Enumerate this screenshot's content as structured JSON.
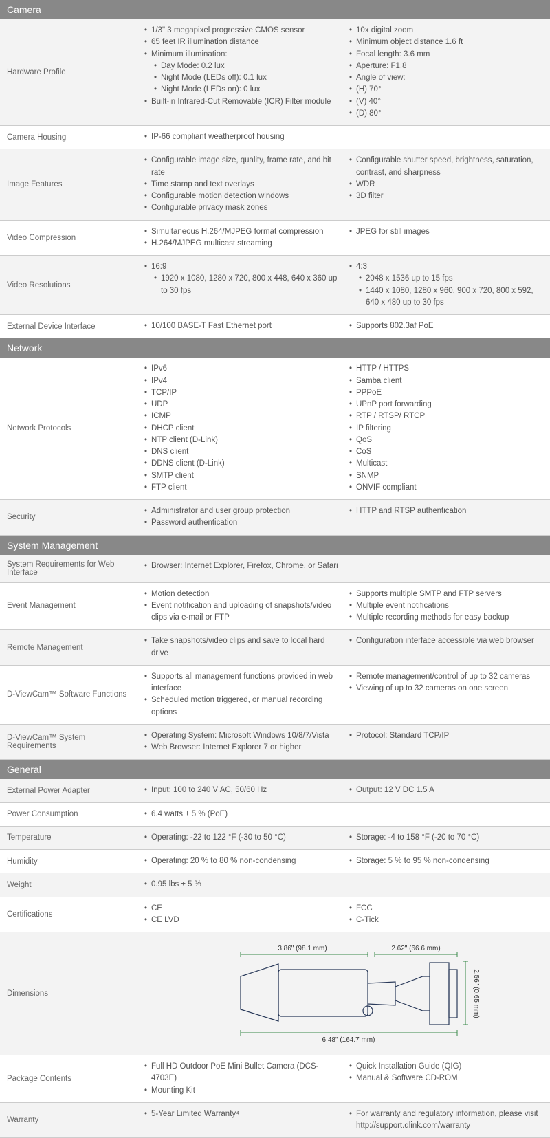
{
  "sections": [
    {
      "title": "Camera",
      "rows": [
        {
          "label": "Hardware Profile",
          "cols": [
            [
              {
                "t": "1/3\" 3 megapixel progressive CMOS sensor"
              },
              {
                "t": "65 feet IR illumination distance"
              },
              {
                "t": "Minimum illumination:"
              },
              {
                "t": "Day Mode: 0.2 lux",
                "indent": 1
              },
              {
                "t": "Night Mode (LEDs off): 0.1 lux",
                "indent": 1
              },
              {
                "t": "Night Mode (LEDs on): 0 lux",
                "indent": 1
              },
              {
                "t": "Built-in Infrared-Cut Removable (ICR) Filter module"
              }
            ],
            [
              {
                "t": "10x digital zoom"
              },
              {
                "t": "Minimum object distance 1.6 ft"
              },
              {
                "t": "Focal length: 3.6 mm"
              },
              {
                "t": "Aperture: F1.8"
              },
              {
                "t": "Angle of view:"
              },
              {
                "t": "(H) 70°"
              },
              {
                "t": "(V) 40°"
              },
              {
                "t": "(D) 80°"
              }
            ]
          ]
        },
        {
          "label": "Camera Housing",
          "cols": [
            [
              {
                "t": "IP-66 compliant weatherproof housing"
              }
            ]
          ]
        },
        {
          "label": "Image Features",
          "cols": [
            [
              {
                "t": "Configurable image size, quality, frame rate, and bit rate"
              },
              {
                "t": "Time stamp and text overlays"
              },
              {
                "t": "Configurable motion detection windows"
              },
              {
                "t": "Configurable privacy mask zones"
              }
            ],
            [
              {
                "t": "Configurable shutter speed, brightness, saturation, contrast, and sharpness"
              },
              {
                "t": "WDR"
              },
              {
                "t": "3D filter"
              }
            ]
          ]
        },
        {
          "label": "Video Compression",
          "cols": [
            [
              {
                "t": "Simultaneous H.264/MJPEG format compression"
              },
              {
                "t": "H.264/MJPEG multicast streaming"
              }
            ],
            [
              {
                "t": "JPEG for still images"
              }
            ]
          ]
        },
        {
          "label": "Video Resolutions",
          "cols": [
            [
              {
                "t": "16:9"
              },
              {
                "t": "1920 x 1080, 1280 x 720, 800 x 448, 640 x 360 up to 30 fps",
                "indent": 1
              }
            ],
            [
              {
                "t": "4:3"
              },
              {
                "t": "2048 x 1536 up to 15 fps",
                "indent": 1
              },
              {
                "t": "1440 x 1080, 1280 x 960, 900 x 720, 800 x 592, 640 x 480 up to 30 fps",
                "indent": 1
              }
            ]
          ]
        },
        {
          "label": "External Device Interface",
          "cols": [
            [
              {
                "t": "10/100 BASE-T Fast Ethernet port"
              }
            ],
            [
              {
                "t": "Supports 802.3af PoE"
              }
            ]
          ]
        }
      ]
    },
    {
      "title": "Network",
      "rows": [
        {
          "label": "Network Protocols",
          "cols": [
            [
              {
                "t": "IPv6"
              },
              {
                "t": "IPv4"
              },
              {
                "t": "TCP/IP"
              },
              {
                "t": "UDP"
              },
              {
                "t": "ICMP"
              },
              {
                "t": "DHCP client"
              },
              {
                "t": "NTP client (D-Link)"
              },
              {
                "t": "DNS client"
              },
              {
                "t": "DDNS client (D-Link)"
              },
              {
                "t": "SMTP client"
              },
              {
                "t": "FTP client"
              }
            ],
            [
              {
                "t": "HTTP / HTTPS"
              },
              {
                "t": "Samba client"
              },
              {
                "t": "PPPoE"
              },
              {
                "t": "UPnP port forwarding"
              },
              {
                "t": "RTP / RTSP/ RTCP"
              },
              {
                "t": "IP filtering"
              },
              {
                "t": "QoS"
              },
              {
                "t": "CoS"
              },
              {
                "t": "Multicast"
              },
              {
                "t": "SNMP"
              },
              {
                "t": "ONVIF compliant"
              }
            ]
          ]
        },
        {
          "label": "Security",
          "cols": [
            [
              {
                "t": "Administrator and user group protection"
              },
              {
                "t": "Password authentication"
              }
            ],
            [
              {
                "t": "HTTP and RTSP authentication"
              }
            ]
          ]
        }
      ]
    },
    {
      "title": "System Management",
      "rows": [
        {
          "label": "System Requirements for Web Interface",
          "cols": [
            [
              {
                "t": "Browser: Internet Explorer, Firefox, Chrome, or Safari"
              }
            ]
          ]
        },
        {
          "label": "Event Management",
          "cols": [
            [
              {
                "t": "Motion detection"
              },
              {
                "t": "Event notification and uploading of snapshots/video clips via e-mail or FTP"
              }
            ],
            [
              {
                "t": "Supports multiple SMTP and FTP servers"
              },
              {
                "t": "Multiple event notifications"
              },
              {
                "t": "Multiple recording methods for easy backup"
              }
            ]
          ]
        },
        {
          "label": "Remote Management",
          "cols": [
            [
              {
                "t": "Take snapshots/video clips and save to local hard drive"
              }
            ],
            [
              {
                "t": "Configuration interface accessible via web browser"
              }
            ]
          ]
        },
        {
          "label": "D-ViewCam™ Software Functions",
          "cols": [
            [
              {
                "t": "Supports all management functions provided in web interface"
              },
              {
                "t": "Scheduled motion triggered, or manual recording options"
              }
            ],
            [
              {
                "t": "Remote management/control of up to 32 cameras"
              },
              {
                "t": "Viewing of up to 32 cameras on one screen"
              }
            ]
          ]
        },
        {
          "label": "D-ViewCam™ System Requirements",
          "cols": [
            [
              {
                "t": "Operating System: Microsoft Windows 10/8/7/Vista"
              },
              {
                "t": "Web Browser: Internet Explorer 7 or higher"
              }
            ],
            [
              {
                "t": "Protocol: Standard TCP/IP"
              }
            ]
          ]
        }
      ]
    },
    {
      "title": "General",
      "rows": [
        {
          "label": "External Power Adapter",
          "cols": [
            [
              {
                "t": "Input: 100 to 240 V AC, 50/60 Hz"
              }
            ],
            [
              {
                "t": "Output: 12 V DC 1.5 A"
              }
            ]
          ]
        },
        {
          "label": "Power Consumption",
          "cols": [
            [
              {
                "t": "6.4 watts ± 5 % (PoE)"
              }
            ]
          ]
        },
        {
          "label": "Temperature",
          "cols": [
            [
              {
                "t": "Operating: -22 to 122 °F (-30 to 50 °C)"
              }
            ],
            [
              {
                "t": "Storage: -4 to 158 °F (-20 to 70 °C)"
              }
            ]
          ]
        },
        {
          "label": "Humidity",
          "cols": [
            [
              {
                "t": "Operating: 20 % to 80 % non-condensing"
              }
            ],
            [
              {
                "t": "Storage: 5 % to 95 % non-condensing"
              }
            ]
          ]
        },
        {
          "label": "Weight",
          "cols": [
            [
              {
                "t": "0.95 lbs ± 5 %"
              }
            ]
          ]
        },
        {
          "label": "Certifications",
          "cols": [
            [
              {
                "t": "CE"
              },
              {
                "t": "CE LVD"
              }
            ],
            [
              {
                "t": "FCC"
              },
              {
                "t": "C-Tick"
              }
            ]
          ]
        },
        {
          "label": "Dimensions",
          "diagram": {
            "dim_3_86": "3.86\" (98.1 mm)",
            "dim_2_62": "2.62\" (66.6 mm)",
            "dim_2_56": "2.56\" (0.65 mm)",
            "dim_6_48": "6.48\" (164.7 mm)"
          }
        },
        {
          "label": "Package Contents",
          "cols": [
            [
              {
                "t": "Full HD Outdoor PoE Mini Bullet Camera (DCS-4703E)"
              },
              {
                "t": "Mounting Kit"
              }
            ],
            [
              {
                "t": "Quick Installation Guide (QIG)"
              },
              {
                "t": "Manual & Software CD-ROM"
              }
            ]
          ]
        },
        {
          "label": "Warranty",
          "cols": [
            [
              {
                "t": "5-Year Limited Warranty⁴"
              }
            ],
            [
              {
                "t": "For warranty and regulatory information, please visit http://support.dlink.com/warranty"
              }
            ]
          ]
        }
      ]
    }
  ]
}
